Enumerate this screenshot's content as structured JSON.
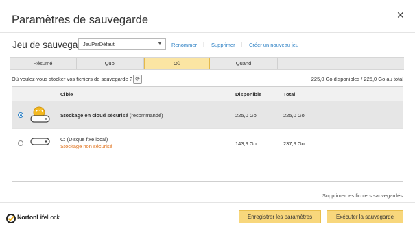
{
  "window": {
    "title": "Paramètres de sauvegarde",
    "minimize": "–",
    "close": "✕"
  },
  "backup_set": {
    "label": "Jeu de sauvegarde",
    "selected": "JeuParDéfaut",
    "links": [
      "Renommer",
      "Supprimer",
      "Créer un nouveau jeu"
    ],
    "separator": "|"
  },
  "tabs": [
    {
      "label": "Résumé",
      "active": false
    },
    {
      "label": "Quoi",
      "active": false
    },
    {
      "label": "Où",
      "active": true
    },
    {
      "label": "Quand",
      "active": false
    }
  ],
  "where": {
    "question": "Où voulez-vous stocker vos fichiers de sauvegarde ?",
    "available_summary": "225,0 Go disponibles / 225,0 Go au total"
  },
  "table": {
    "headers": {
      "target": "Cible",
      "available": "Disponible",
      "total": "Total"
    },
    "rows": [
      {
        "selected": true,
        "icon": "cloud-drive-icon",
        "name_bold": "Stockage en cloud sécurisé",
        "name_extra": " (recommandé)",
        "warning": "",
        "available": "225,0 Go",
        "total": "225,0 Go"
      },
      {
        "selected": false,
        "icon": "hard-drive-icon",
        "name_bold": "",
        "name_extra": "C:  (Disque fixe local)",
        "warning": "Stockage non sécurisé",
        "available": "143,9 Go",
        "total": "237,9 Go"
      }
    ]
  },
  "footer": {
    "delete_link": "Supprimer les fichiers sauvegardés",
    "save_button": "Enregistrer les paramètres",
    "run_button": "Exécuter la sauvegarde",
    "logo_brand": "NortonLife",
    "logo_suffix": "Lock",
    "logo_mark": "ᴿ"
  },
  "colors": {
    "accent_yellow": "#f8d77c",
    "link_blue": "#2a7fc4",
    "warning_orange": "#e0711a"
  }
}
